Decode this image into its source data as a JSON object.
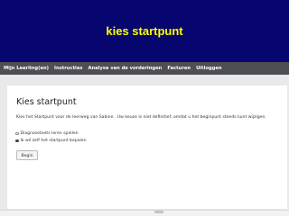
{
  "slide": {
    "title": "kies startpunt",
    "header_color": "#06066e",
    "title_color": "#ffff00"
  },
  "nav": {
    "items": [
      "Mijn Leerling(en)",
      "Instructies",
      "Analyse van de vorderingen",
      "Facturen",
      "Uitloggen"
    ]
  },
  "page": {
    "title": "Kies startpunt",
    "intro": "Kies het Startpunt voor de leerweg van Sabine . Uw keuze is niet definitief, omdat u het beginpunt steeds kunt wijzigen.",
    "options": [
      {
        "label": "Diagnosetoets leren spellen",
        "selected": false
      },
      {
        "label": "Ik wil zelf het startpunt bepalen",
        "selected": true
      }
    ],
    "begin_label": "Begin"
  }
}
